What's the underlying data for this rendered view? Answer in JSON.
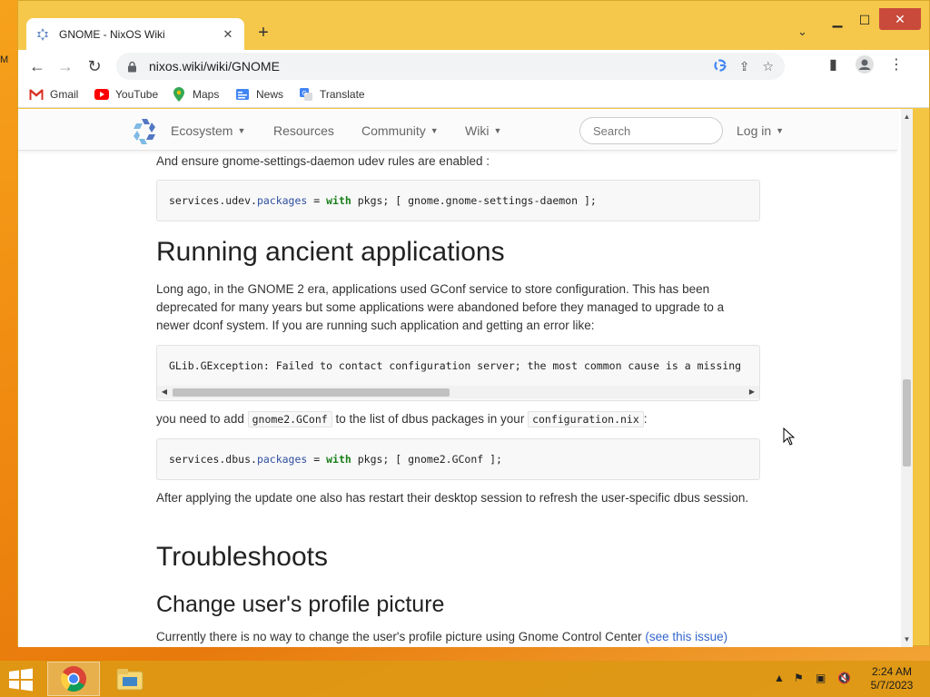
{
  "desktop": {
    "left_edge_text": "M"
  },
  "browser": {
    "tab": {
      "title": "GNOME - NixOS Wiki",
      "close_glyph": "✕"
    },
    "new_tab_glyph": "+",
    "tab_menu_glyph": "⌄",
    "window_controls": {
      "minimize": "▁",
      "maximize": "☐",
      "close": "✕"
    },
    "url": "nixos.wiki/wiki/GNOME",
    "bookmarks": [
      {
        "label": "Gmail"
      },
      {
        "label": "YouTube"
      },
      {
        "label": "Maps"
      },
      {
        "label": "News"
      },
      {
        "label": "Translate"
      }
    ]
  },
  "site": {
    "nav": {
      "ecosystem": "Ecosystem",
      "resources": "Resources",
      "community": "Community",
      "wiki": "Wiki",
      "search_placeholder": "Search",
      "login": "Log in"
    }
  },
  "article": {
    "p_udev": "And ensure gnome-settings-daemon udev rules are enabled :",
    "code_udev": {
      "a": "services.udev.",
      "b": "packages",
      "c": " = ",
      "d": "with",
      "e": " pkgs; [ gnome.gnome-settings-daemon ];"
    },
    "h_ancient": "Running ancient applications",
    "p_ancient": "Long ago, in the GNOME 2 era, applications used GConf service to store configuration. This has been deprecated for many years but some applications were abandoned before they managed to upgrade to a newer dconf system. If you are running such application and getting an error like:",
    "code_error": "GLib.GException: Failed to contact configuration server; the most common cause is a missing",
    "p_need_1": "you need to add ",
    "inline_gconf": "gnome2.GConf",
    "p_need_2": " to the list of dbus packages in your ",
    "inline_config": "configuration.nix",
    "p_need_3": ":",
    "code_dbus": {
      "a": "services.dbus.",
      "b": "packages",
      "c": " = ",
      "d": "with",
      "e": " pkgs; [ gnome2.GConf ];"
    },
    "p_after": "After applying the update one also has restart their desktop session to refresh the user-specific dbus session.",
    "h_trouble": "Troubleshoots",
    "h_profile": "Change user's profile picture",
    "p_profile": "Currently there is no way to change the user's profile picture using Gnome Control Center ",
    "p_profile_link": "(see this issue)"
  },
  "taskbar": {
    "time": "2:24 AM",
    "date": "5/7/2023"
  }
}
